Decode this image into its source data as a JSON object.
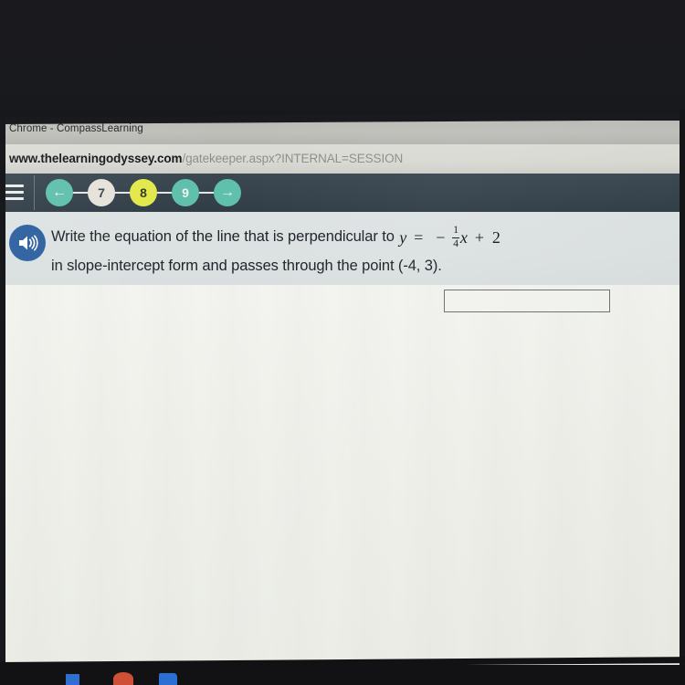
{
  "window": {
    "title": "Chrome - CompassLearning"
  },
  "address_bar": {
    "domain": "www.thelearningodyssey.com",
    "path": "/gatekeeper.aspx?INTERNAL=SESSION"
  },
  "nav": {
    "menu_icon": "hamburger-icon",
    "back_label": "←",
    "forward_label": "→",
    "steps": [
      {
        "label": "7",
        "state": "visited"
      },
      {
        "label": "8",
        "state": "current"
      },
      {
        "label": "9",
        "state": "upcoming"
      }
    ]
  },
  "question": {
    "audio_icon": "speaker-icon",
    "line1_before": "Write the equation of the line that is perpendicular to",
    "line2": "in slope-intercept form and passes through the point (-4, 3).",
    "equation": {
      "lhs": "y",
      "equals": "=",
      "minus": "−",
      "fraction_numerator": "1",
      "fraction_denominator": "4",
      "variable": "x",
      "plus": "+",
      "constant": "2",
      "plain": "y = -1/4 x + 2"
    }
  },
  "answer": {
    "value": "",
    "placeholder": ""
  },
  "colors": {
    "nav_bar": "#36434d",
    "step_teal": "#5fc0ac",
    "step_current": "#e2e84b",
    "step_visited": "#e6e2d9",
    "audio_blue": "#2d60a0",
    "question_panel": "#dde2e3",
    "page_background": "#eff0ea"
  },
  "taskbar": {
    "icons": [
      "blue-app-icon",
      "red-app-icon",
      "blue-explorer-icon"
    ]
  }
}
